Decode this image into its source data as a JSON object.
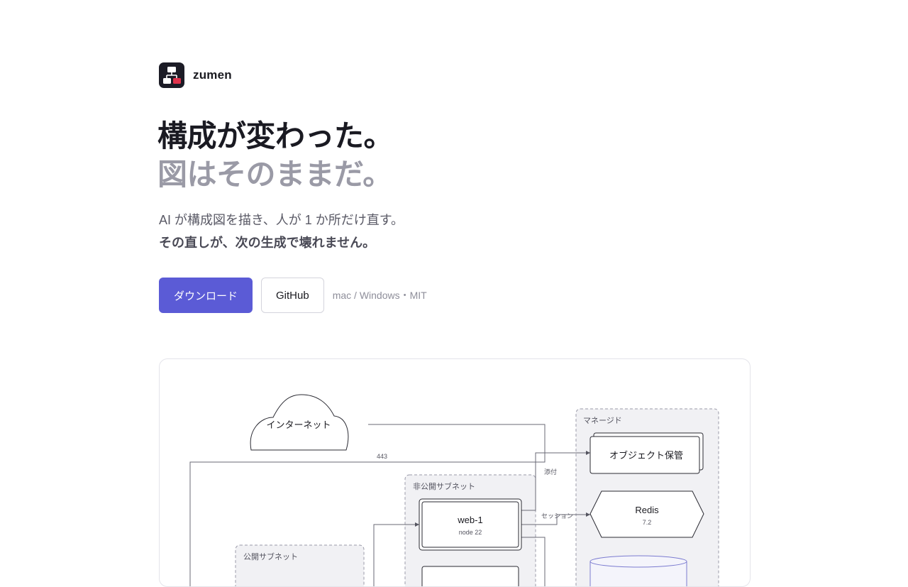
{
  "brand": {
    "name": "zumen"
  },
  "hero": {
    "line1": "構成が変わった。",
    "line2": "図はそのままだ。"
  },
  "lead": {
    "line1": "AI が構成図を描き、人が 1 か所だけ直す。",
    "line2": "その直しが、次の生成で壊れません。"
  },
  "cta": {
    "download": "ダウンロード",
    "github": "GitHub",
    "meta": "mac / Windows・MIT"
  },
  "diagram": {
    "internet": "インターネット",
    "edge_443": "443",
    "managed_group": "マネージド",
    "object_storage": "オブジェクト保管",
    "redis": "Redis",
    "redis_version": "7.2",
    "private_subnet": "非公開サブネット",
    "web1": "web-1",
    "web1_sub": "node 22",
    "public_subnet": "公開サブネット",
    "edge_attach": "添付",
    "edge_session": "セッション"
  }
}
